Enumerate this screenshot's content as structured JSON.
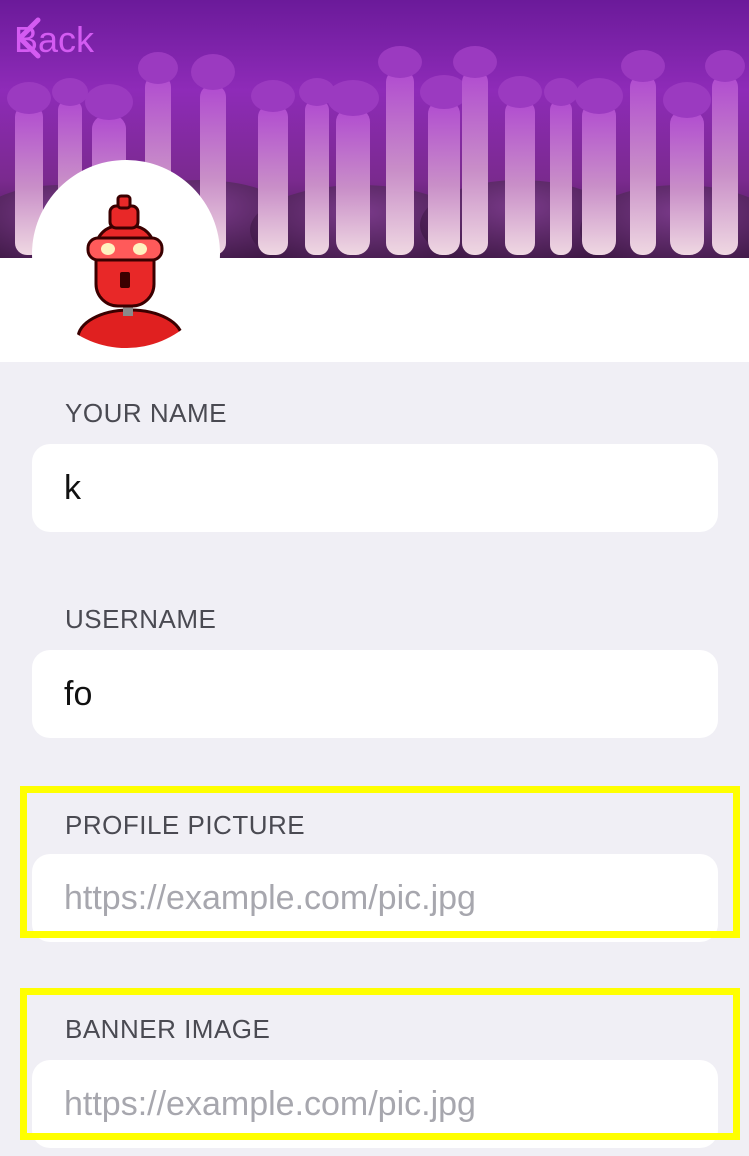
{
  "nav": {
    "back_label": "Back"
  },
  "form": {
    "name": {
      "label": "YOUR NAME",
      "value": "k"
    },
    "username": {
      "label": "USERNAME",
      "value": "fo"
    },
    "profile_picture": {
      "label": "PROFILE PICTURE",
      "placeholder": "https://example.com/pic.jpg",
      "value": ""
    },
    "banner_image": {
      "label": "BANNER IMAGE",
      "placeholder": "https://example.com/pic.jpg",
      "value": ""
    }
  },
  "colors": {
    "accent": "#d45bf2",
    "highlight": "#ffff00",
    "background": "#f0eff5"
  }
}
